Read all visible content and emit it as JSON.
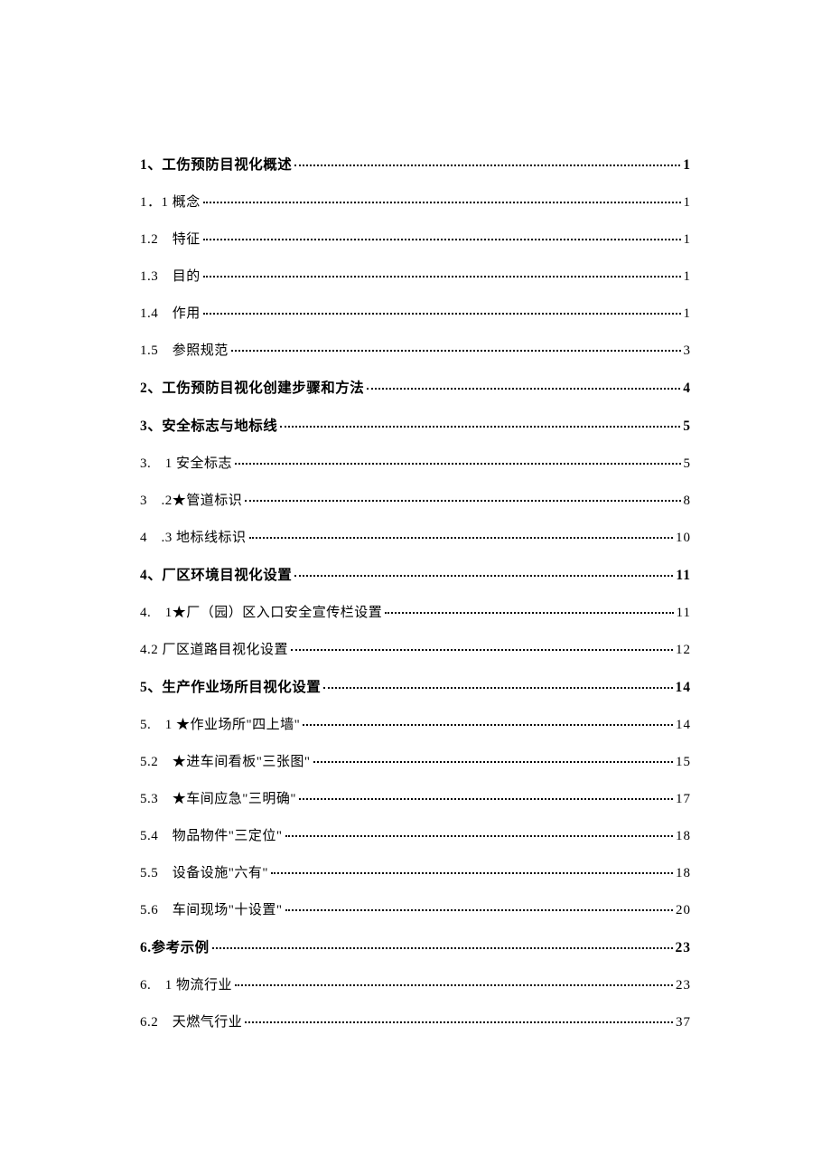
{
  "toc": [
    {
      "type": "section",
      "label": "1、工伤预防目视化概述",
      "page": "1"
    },
    {
      "type": "sub",
      "label": "1．1 概念",
      "page": "1"
    },
    {
      "type": "sub",
      "label": "1.2　特征",
      "page": "1"
    },
    {
      "type": "sub",
      "label": "1.3　目的",
      "page": "1"
    },
    {
      "type": "sub",
      "label": "1.4　作用",
      "page": "1"
    },
    {
      "type": "sub",
      "label": "1.5　参照规范",
      "page": "3"
    },
    {
      "type": "section",
      "label": "2、工伤预防目视化创建步骤和方法",
      "page": "4"
    },
    {
      "type": "section",
      "label": "3、安全标志与地标线",
      "page": "5"
    },
    {
      "type": "sub",
      "label": "3.　1 安全标志",
      "page": "5"
    },
    {
      "type": "sub",
      "label": "3　.2★管道标识",
      "page": "8"
    },
    {
      "type": "sub",
      "label": "4　.3 地标线标识",
      "page": "10"
    },
    {
      "type": "section",
      "label": "4、厂区环境目视化设置",
      "page": "11"
    },
    {
      "type": "sub",
      "label": "4.　1★厂（园）区入口安全宣传栏设置",
      "page": "11"
    },
    {
      "type": "sub",
      "label": "4.2 厂区道路目视化设置",
      "page": "12"
    },
    {
      "type": "section",
      "label": "5、生产作业场所目视化设置",
      "page": "14"
    },
    {
      "type": "sub",
      "label": "5.　1 ★作业场所\"四上墙\"",
      "page": "14"
    },
    {
      "type": "sub",
      "label": "5.2　★进车间看板\"三张图\"",
      "page": "15"
    },
    {
      "type": "sub",
      "label": "5.3　★车间应急\"三明确\"",
      "page": "17"
    },
    {
      "type": "sub",
      "label": "5.4　物品物件\"三定位\"",
      "page": "18"
    },
    {
      "type": "sub",
      "label": "5.5　设备设施\"六有\"",
      "page": "18"
    },
    {
      "type": "sub",
      "label": "5.6　车间现场\"十设置\"",
      "page": "20"
    },
    {
      "type": "section",
      "label": "6.参考示例",
      "page": "23"
    },
    {
      "type": "sub",
      "label": "6.　1 物流行业",
      "page": "23"
    },
    {
      "type": "sub",
      "label": "6.2　天燃气行业",
      "page": "37"
    }
  ]
}
